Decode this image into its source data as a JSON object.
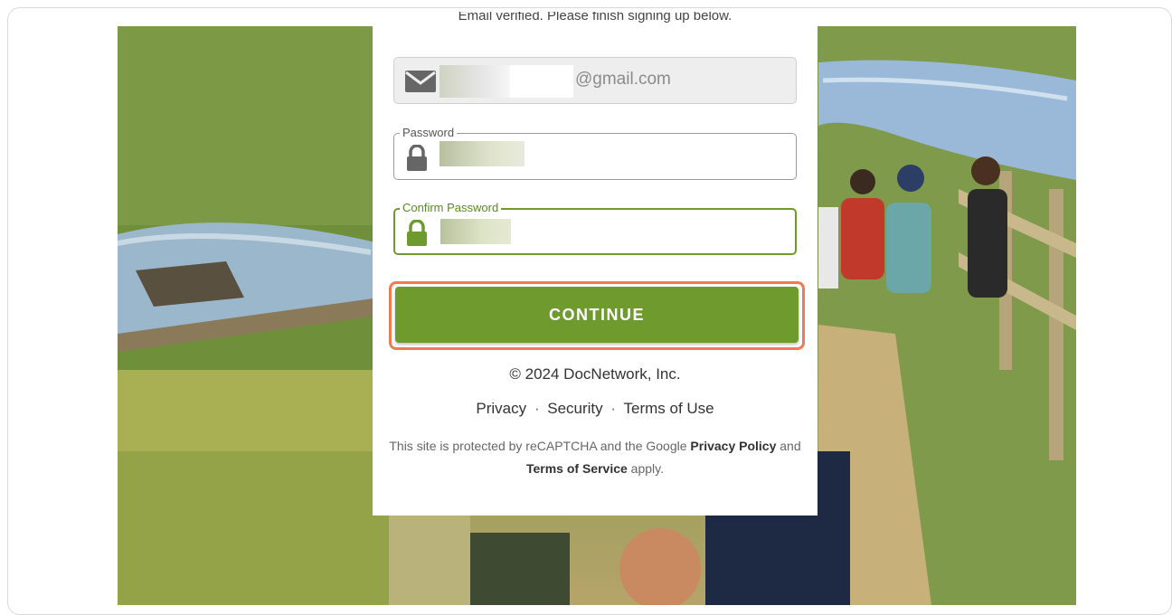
{
  "header": {
    "verified_text": "Email verified. Please finish signing up below."
  },
  "form": {
    "email_value": "@gmail.com",
    "password_label": "Password",
    "confirm_password_label": "Confirm Password",
    "continue_label": "CONTINUE"
  },
  "footer": {
    "copyright": "© 2024 DocNetwork, Inc.",
    "links": [
      "Privacy",
      "Security",
      "Terms of Use"
    ],
    "separator": "·",
    "recaptcha_prefix": "This site is protected by reCAPTCHA and the Google",
    "recaptcha_privacy": "Privacy Policy",
    "recaptcha_and": "and",
    "recaptcha_terms": "Terms of Service",
    "recaptcha_suffix": "apply."
  },
  "colors": {
    "accent_green": "#6e9a2e",
    "focus_outline": "#ee7b52"
  },
  "icons": {
    "email": "mail-icon",
    "password": "lock-icon",
    "confirm_password": "lock-icon"
  }
}
